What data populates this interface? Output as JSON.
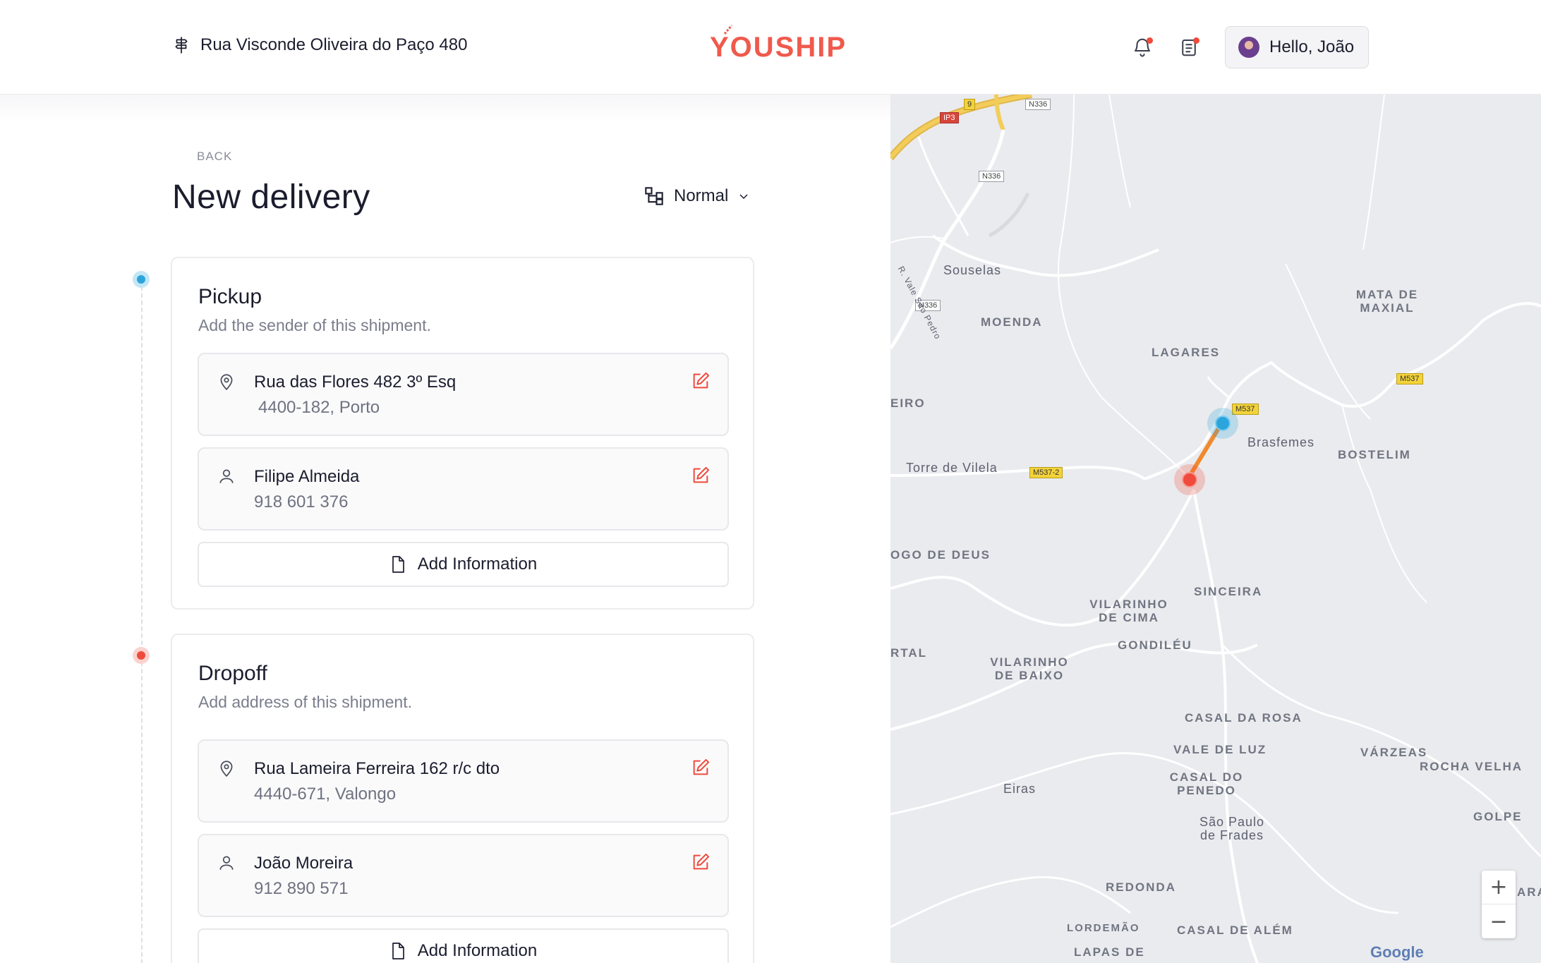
{
  "header": {
    "address": "Rua Visconde Oliveira do Paço 480",
    "logo": "YOUSHIP",
    "user_greeting": "Hello, João",
    "brand_color": "#ef5a4c"
  },
  "page": {
    "back_label": "BACK",
    "title": "New delivery",
    "priority": "Normal"
  },
  "pickup": {
    "title": "Pickup",
    "subtitle": "Add the sender of this shipment.",
    "address_line1": "Rua das Flores 482 3º Esq",
    "address_line2": "4400-182, Porto",
    "contact_name": "Filipe Almeida",
    "contact_phone": "918 601 376",
    "add_info_label": "Add Information"
  },
  "dropoff": {
    "title": "Dropoff",
    "subtitle": "Add address of this shipment.",
    "address_line1": "Rua Lameira Ferreira 162 r/c dto",
    "address_line2": "4440-671, Valongo",
    "contact_name": "João Moreira",
    "contact_phone": "912 890 571",
    "add_info_label": "Add Information"
  },
  "map": {
    "areas": {
      "mata": "MATA DE MAXIAL",
      "moenda": "MOENDA",
      "lagares": "LAGARES",
      "eiro": "EIRO",
      "bostelim": "BOSTELIM",
      "ogo": "OGO DE DEUS",
      "sinceira": "SINCEIRA",
      "vilarinho_cima": "VILARINHO DE CIMA",
      "gondileu": "GONDILÉU",
      "rtal": "RTAL",
      "vilarinho_baixo": "VILARINHO DE BAIXO",
      "casal_rosa": "CASAL DA ROSA",
      "vale_luz": "VALE DE LUZ",
      "varzeas": "VÁRZEAS",
      "rocha_velha": "ROCHA VELHA",
      "casal_penedo": "CASAL DO PENEDO",
      "golpe": "GOLPE",
      "redonda": "REDONDA",
      "ara": "ARA",
      "lordemao": "LORDEMÃO",
      "casal_alem": "CASAL DE ALÉM",
      "lapas": "LAPAS DE"
    },
    "places": {
      "souselas": "Souselas",
      "brasfemes": "Brasfemes",
      "torre": "Torre de Vilela",
      "eiras": "Eiras",
      "sao_paulo": "São Paulo de Frades"
    },
    "roads": {
      "n336a": "N336",
      "n336b": "N336",
      "n336c": "N336",
      "ip3": "IP3",
      "nine": "9",
      "m537a": "M537",
      "m537b": "M537",
      "m5372": "M537-2",
      "vale": "R. Vale São Pedro"
    },
    "zoom_in": "+",
    "zoom_out": "−",
    "attribution": "Google"
  },
  "colors": {
    "pickup_marker": "#2ba5dc",
    "dropoff_marker": "#ef4a3c",
    "route": "#f08a2c"
  }
}
